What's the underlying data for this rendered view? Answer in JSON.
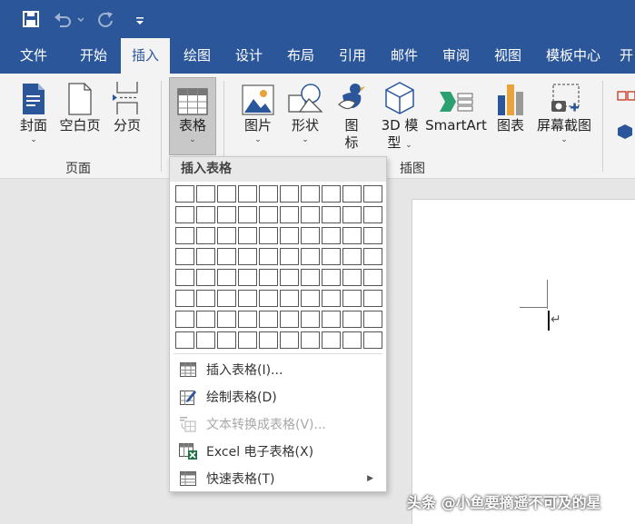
{
  "quick_access": {
    "save_icon": "save-icon",
    "undo_icon": "undo-icon",
    "redo_icon": "redo-icon",
    "customize_icon": "customize-icon"
  },
  "tabs": [
    {
      "label": "文件"
    },
    {
      "label": "开始"
    },
    {
      "label": "插入",
      "active": true
    },
    {
      "label": "绘图"
    },
    {
      "label": "设计"
    },
    {
      "label": "布局"
    },
    {
      "label": "引用"
    },
    {
      "label": "邮件"
    },
    {
      "label": "审阅"
    },
    {
      "label": "视图"
    },
    {
      "label": "模板中心"
    },
    {
      "label": "开"
    }
  ],
  "ribbon": {
    "pages_group": {
      "label": "页面",
      "cover": "封面",
      "blank": "空白页",
      "break": "分页"
    },
    "table_btn": "表格",
    "illustrations_group": {
      "label": "插图",
      "picture": "图片",
      "shapes": "形状",
      "icons_1": "图",
      "icons_2": "标",
      "model3d_1": "3D 模",
      "model3d_2": "型",
      "smartart": "SmartArt",
      "chart": "图表",
      "screenshot": "屏幕截图"
    },
    "chevron": "⌄"
  },
  "dropdown": {
    "header": "插入表格",
    "grid_cols": 10,
    "grid_rows": 8,
    "items": [
      {
        "label": "插入表格(I)...",
        "enabled": true
      },
      {
        "label": "绘制表格(D)",
        "enabled": true
      },
      {
        "label": "文本转换成表格(V)...",
        "enabled": false
      },
      {
        "label": "Excel 电子表格(X)",
        "enabled": true
      },
      {
        "label": "快速表格(T)",
        "enabled": true,
        "submenu": "▶"
      }
    ]
  },
  "document": {
    "paragraph_mark": "↵"
  },
  "watermark": "头条 @小鱼要摘遥不可及的星",
  "colors": {
    "accent": "#2b579a",
    "ribbon_bg": "#f3f3f3",
    "excel_green": "#1e7145"
  }
}
